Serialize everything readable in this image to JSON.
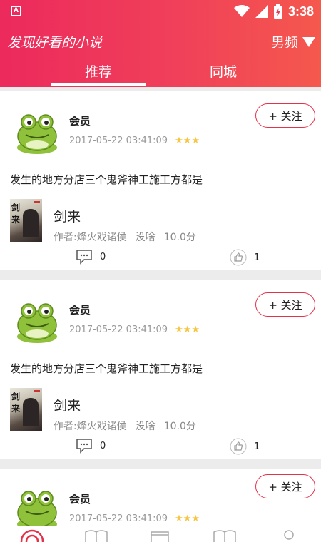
{
  "status_bar": {
    "time": "3:38",
    "app_icon_letter": "A"
  },
  "header": {
    "title": "发现好看的小说",
    "gender_filter": "男频",
    "tabs": [
      {
        "label": "推荐",
        "active": true
      },
      {
        "label": "同城",
        "active": false
      }
    ]
  },
  "colors": {
    "accent": "#e2334b",
    "header_start": "#ec2a5c",
    "header_end": "#f5584d",
    "star": "#f6c643"
  },
  "feed": [
    {
      "username": "会员",
      "timestamp": "2017-05-22 03:41:09",
      "stars": "★★★",
      "follow_label": "+ 关注",
      "text": "发生的地方分店三个鬼斧神工施工方都是",
      "book": {
        "title": "剑来",
        "author": "作者:烽火戏诸侯",
        "category": "没啥",
        "score": "10.0分",
        "cover_chars": [
          "剑",
          "来"
        ]
      },
      "comments": "0",
      "likes": "1"
    },
    {
      "username": "会员",
      "timestamp": "2017-05-22 03:41:09",
      "stars": "★★★",
      "follow_label": "+ 关注",
      "text": "发生的地方分店三个鬼斧神工施工方都是",
      "book": {
        "title": "剑来",
        "author": "作者:烽火戏诸侯",
        "category": "没啥",
        "score": "10.0分",
        "cover_chars": [
          "剑",
          "来"
        ]
      },
      "comments": "0",
      "likes": "1"
    },
    {
      "username": "会员",
      "timestamp": "2017-05-22 03:41:09",
      "stars": "★★★",
      "follow_label": "+ 关注"
    }
  ],
  "bottom_nav": [
    {
      "icon": "target-icon",
      "active": true
    },
    {
      "icon": "book-icon",
      "active": false
    },
    {
      "icon": "stack-icon",
      "active": false
    },
    {
      "icon": "open-book-icon",
      "active": false
    },
    {
      "icon": "profile-icon",
      "active": false
    }
  ]
}
